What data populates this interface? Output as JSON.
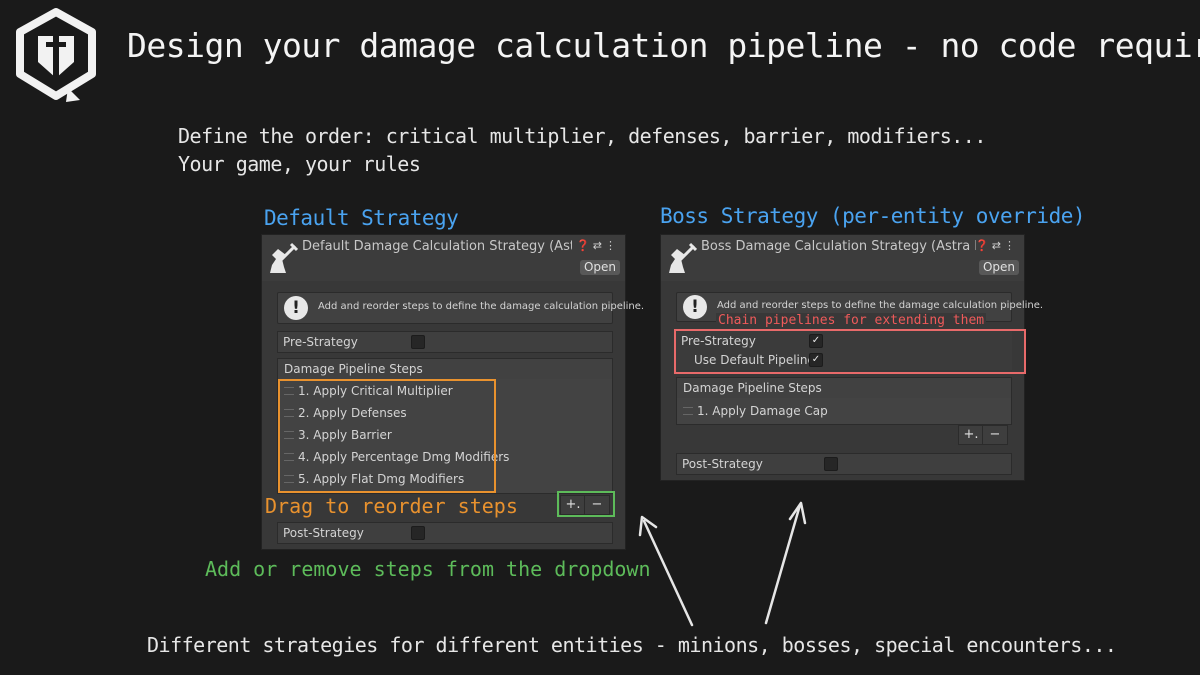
{
  "header": {
    "title": "Design your damage calculation pipeline - no code required",
    "subtitle_line1": "Define the order: critical multiplier, defenses, barrier, modifiers...",
    "subtitle_line2": "Your game, your rules"
  },
  "default_panel": {
    "label": "Default Strategy",
    "title": "Default Damage Calculation Strategy (Astra H",
    "open_label": "Open",
    "help_text": "Add and reorder steps to define the damage calculation pipeline.",
    "pre_strategy_label": "Pre-Strategy",
    "pre_strategy_checked": false,
    "list_header": "Damage Pipeline Steps",
    "steps": [
      "1. Apply Critical Multiplier",
      "2. Apply Defenses",
      "3. Apply Barrier",
      "4. Apply Percentage Dmg Modifiers",
      "5. Apply Flat Dmg Modifiers"
    ],
    "plus_label": "+.",
    "minus_label": "−",
    "post_strategy_label": "Post-Strategy",
    "post_strategy_checked": false
  },
  "boss_panel": {
    "label": "Boss Strategy (per-entity override)",
    "title": "Boss Damage Calculation Strategy (Astra He",
    "open_label": "Open",
    "help_text": "Add and reorder steps to define the damage calculation pipeline.",
    "pre_strategy_label": "Pre-Strategy",
    "pre_strategy_checked": true,
    "use_default_label": "Use Default Pipeline",
    "use_default_checked": true,
    "list_header": "Damage Pipeline Steps",
    "steps": [
      "1. Apply Damage Cap"
    ],
    "plus_label": "+.",
    "minus_label": "−",
    "post_strategy_label": "Post-Strategy",
    "post_strategy_checked": false
  },
  "annotations": {
    "drag": "Drag to reorder steps",
    "add_remove": "Add or remove steps from the dropdown",
    "chain": "Chain pipelines for extending them",
    "bottom": "Different strategies for different entities - minions, bosses, special encounters..."
  },
  "icons": {
    "logo": "shield-sword-logo",
    "panel_icon": "chess-knight-sword-icon",
    "help": "exclamation-icon",
    "header_help": "question-circle-icon",
    "header_settings": "sliders-icon",
    "header_menu": "kebab-menu-icon",
    "checkmark": "checkmark-icon"
  },
  "colors": {
    "background": "#1a1a1a",
    "panel": "#383838",
    "strategy_label": "#4aa3f0",
    "orange": "#e9922e",
    "green": "#5dbb5a",
    "red": "#ee5a5a"
  }
}
